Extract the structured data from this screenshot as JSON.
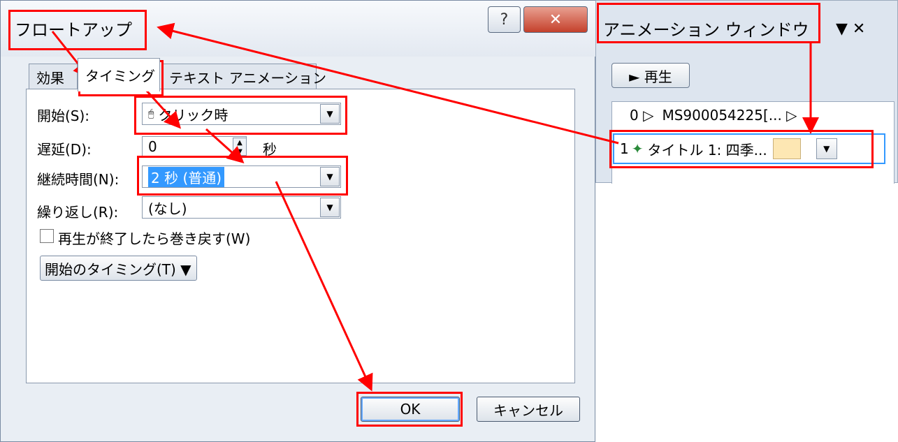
{
  "dialog": {
    "title": "フロートアップ",
    "help_icon": "?",
    "close_icon": "✕",
    "tabs": [
      {
        "label": "効果"
      },
      {
        "label": "タイミング"
      },
      {
        "label": "テキスト アニメーション"
      }
    ],
    "fields": {
      "start_label": "開始(S):",
      "start_value": "クリック時",
      "delay_label": "遅延(D):",
      "delay_value": "0",
      "delay_unit": "秒",
      "duration_label": "継続時間(N):",
      "duration_value": "2 秒 (普通)",
      "repeat_label": "繰り返し(R):",
      "repeat_value": "(なし)"
    },
    "rewind_label": "再生が終了したら巻き戻す(W)",
    "timing_button": "開始のタイミング(T) ▼",
    "ok": "OK",
    "cancel": "キャンセル"
  },
  "pane": {
    "title": "アニメーション ウィンドウ",
    "controls": "▼ ✕",
    "play": "► 再生",
    "items": [
      {
        "index": "0 ▷",
        "name": "MS900054225[... ▷"
      },
      {
        "index": "1",
        "name": "タイトル 1: 四季..."
      }
    ]
  },
  "colors": {
    "annotation": "#ff0000",
    "selection": "#3399ff",
    "close_button": "#c4402b"
  }
}
